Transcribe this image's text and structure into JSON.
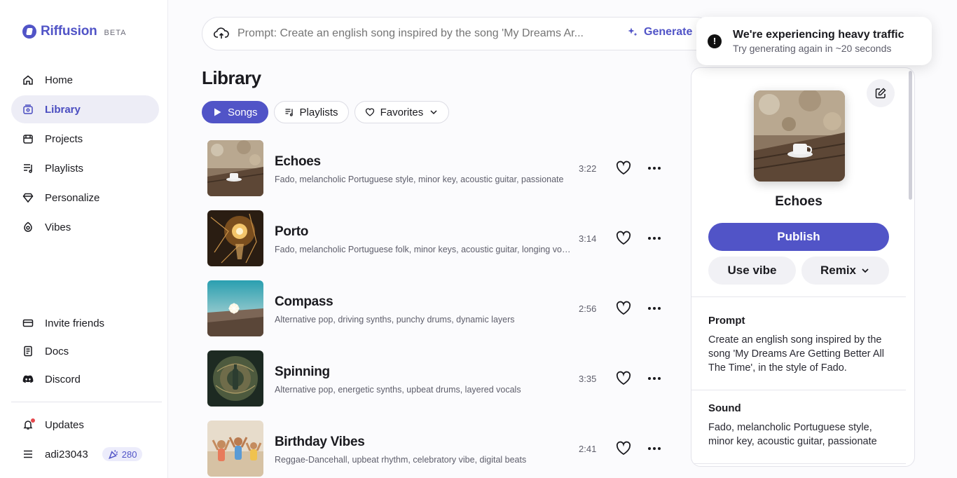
{
  "brand": {
    "name": "Riffusion",
    "badge": "BETA",
    "color": "#5154c7"
  },
  "sidebar": {
    "items": [
      {
        "label": "Home",
        "icon": "home-icon"
      },
      {
        "label": "Library",
        "icon": "library-icon",
        "active": true
      },
      {
        "label": "Projects",
        "icon": "projects-icon"
      },
      {
        "label": "Playlists",
        "icon": "playlists-icon"
      },
      {
        "label": "Personalize",
        "icon": "gem-icon"
      },
      {
        "label": "Vibes",
        "icon": "vibes-icon"
      }
    ],
    "bottom": [
      {
        "label": "Invite friends",
        "icon": "ticket-icon"
      },
      {
        "label": "Docs",
        "icon": "docs-icon"
      },
      {
        "label": "Discord",
        "icon": "discord-icon"
      }
    ],
    "updates_label": "Updates",
    "username": "adi23043",
    "credits": "280"
  },
  "prompt": {
    "placeholder": "Prompt: Create an english song inspired by the song 'My Dreams Ar...",
    "generate_label": "Generate"
  },
  "library": {
    "title": "Library",
    "filters": {
      "songs": "Songs",
      "playlists": "Playlists",
      "favorites": "Favorites"
    },
    "songs": [
      {
        "title": "Echoes",
        "desc": "Fado, melancholic Portuguese style, minor key, acoustic guitar, passionate",
        "duration": "3:22"
      },
      {
        "title": "Porto",
        "desc": "Fado, melancholic Portuguese folk, minor keys, acoustic guitar, longing vocals",
        "duration": "3:14"
      },
      {
        "title": "Compass",
        "desc": "Alternative pop, driving synths, punchy drums, dynamic layers",
        "duration": "2:56"
      },
      {
        "title": "Spinning",
        "desc": "Alternative pop, energetic synths, upbeat drums, layered vocals",
        "duration": "3:35"
      },
      {
        "title": "Birthday Vibes",
        "desc": "Reggae-Dancehall, upbeat rhythm, celebratory vibe, digital beats",
        "duration": "2:41"
      }
    ]
  },
  "toast": {
    "title": "We're experiencing heavy traffic",
    "message": "Try generating again in ~20 seconds"
  },
  "detail": {
    "title": "Echoes",
    "publish_label": "Publish",
    "use_vibe_label": "Use vibe",
    "remix_label": "Remix",
    "prompt_label": "Prompt",
    "prompt_text": "Create an english song inspired by the song 'My Dreams Are Getting Better All The Time', in the style of Fado.",
    "sound_label": "Sound",
    "sound_text": "Fado, melancholic Portuguese style, minor key, acoustic guitar, passionate"
  }
}
